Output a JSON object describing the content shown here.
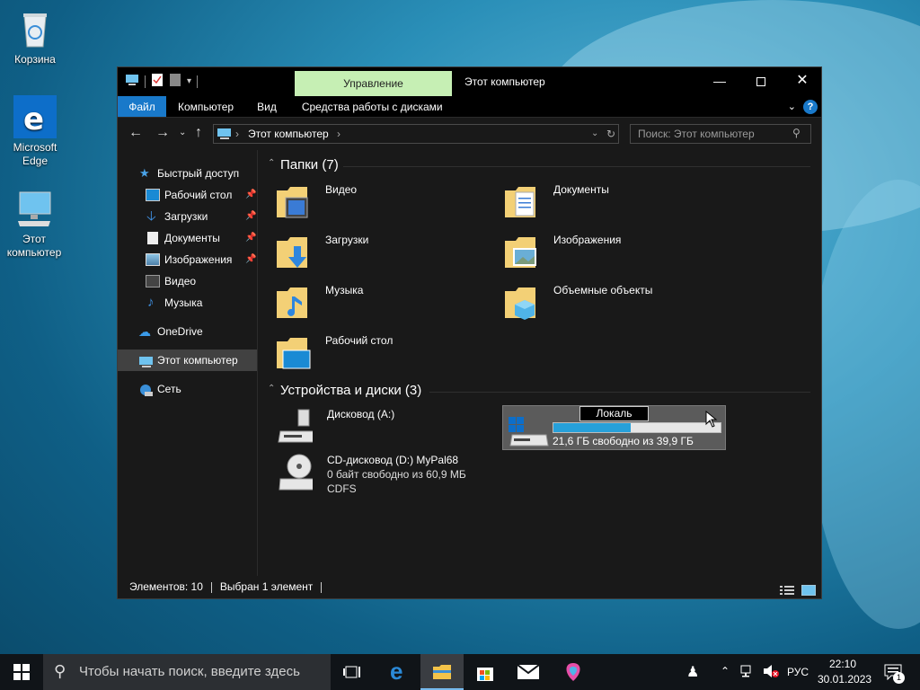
{
  "desktop": {
    "icons": [
      {
        "label": "Корзина"
      },
      {
        "label": "Microsoft Edge"
      },
      {
        "label": "Этот компьютер"
      }
    ]
  },
  "window": {
    "title": "Этот компьютер",
    "context_tab": "Управление",
    "ribbon_tabs": {
      "file": "Файл",
      "computer": "Компьютер",
      "view": "Вид",
      "disk_tools": "Средства работы с дисками"
    },
    "address": "Этот компьютер",
    "search_placeholder": "Поиск: Этот компьютер",
    "help": "?"
  },
  "nav_pane": {
    "quick_access": "Быстрый доступ",
    "items": [
      {
        "label": "Рабочий стол",
        "pinned": true
      },
      {
        "label": "Загрузки",
        "pinned": true
      },
      {
        "label": "Документы",
        "pinned": true
      },
      {
        "label": "Изображения",
        "pinned": true
      },
      {
        "label": "Видео",
        "pinned": false
      },
      {
        "label": "Музыка",
        "pinned": false
      }
    ],
    "onedrive": "OneDrive",
    "this_pc": "Этот компьютер",
    "network": "Сеть"
  },
  "folders": {
    "header": "Папки (7)",
    "items": [
      "Видео",
      "Документы",
      "Загрузки",
      "Изображения",
      "Музыка",
      "Объемные объекты",
      "Рабочий стол"
    ]
  },
  "devices": {
    "header": "Устройства и диски (3)",
    "floppy": {
      "name": "Дисковод (A:)"
    },
    "cd": {
      "name": "CD-дисковод (D:) MyPal68",
      "free": "0 байт свободно из 60,9 МБ",
      "fs": "CDFS"
    },
    "local": {
      "rename_text": "Локаль",
      "free": "21,6 ГБ свободно из 39,9 ГБ",
      "used_fraction": 0.46
    }
  },
  "status": {
    "count": "Элементов: 10",
    "selected": "Выбран 1 элемент"
  },
  "taskbar": {
    "search_placeholder": "Чтобы начать поиск, введите здесь",
    "lang": "РУС",
    "time": "22:10",
    "date": "30.01.2023",
    "notifications": "1"
  }
}
